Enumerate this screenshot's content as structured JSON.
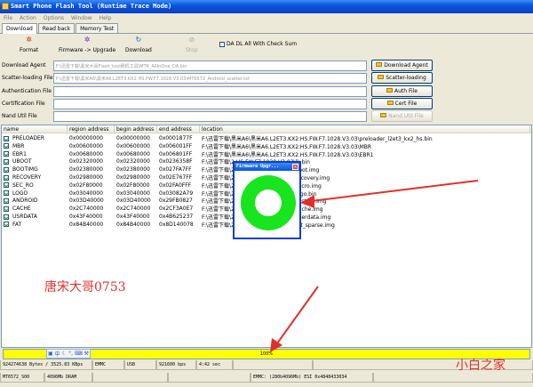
{
  "window": {
    "title": "Smart Phone Flash Tool (Runtime Trace Mode)"
  },
  "menu": [
    "File",
    "Action",
    "Options",
    "Window",
    "Help"
  ],
  "tabs": [
    "Download",
    "Read back",
    "Memory Test"
  ],
  "toolbar": {
    "format": "Format",
    "firmware_upgrade": "Firmware -> Upgrade",
    "download": "Download",
    "stop": "Stop",
    "da_dl_all": "DA DL All With Check Sum"
  },
  "fields": [
    {
      "label": "Download Agent",
      "value": "F:\\迅雷下载\\黑米大哥Flash_tool刷机工具\\MTK_AllInOne_DA.bin",
      "button": "Download Agent",
      "enabled": true
    },
    {
      "label": "Scatter-loading File",
      "value": "F:\\迅雷下载\\黑米A6\\黑米A6.L2ET3.KX2.HS.FW.F7.1028.V3.03\\MT6572_Android_scatter.txt",
      "button": "Scatter-loading",
      "enabled": true
    },
    {
      "label": "Authentication File",
      "value": "",
      "button": "Auth File",
      "enabled": true
    },
    {
      "label": "Certification File",
      "value": "",
      "button": "Cert File",
      "enabled": true
    },
    {
      "label": "Nand Util File",
      "value": "",
      "button": "Nand Util File",
      "enabled": false
    }
  ],
  "table": {
    "headers": [
      "name",
      "region address",
      "begin address",
      "end address",
      "location"
    ],
    "rows": [
      {
        "name": "PRELOADER",
        "region": "0x00000000",
        "begin": "0x00000000",
        "end": "0x0001877F",
        "location": "F:\\迅雷下载\\黑米A6\\黑米A6.L2ET3.KX2.HS.FW.F7.1028.V3.03\\preloader_l2et3_kx2_hs.bin"
      },
      {
        "name": "MBR",
        "region": "0x00600000",
        "begin": "0x00600000",
        "end": "0x006001FF",
        "location": "F:\\迅雷下载\\黑米A6\\黑米A6.L2ET3.KX2.HS.FW.F7.1028.V3.03\\MBR"
      },
      {
        "name": "EBR1",
        "region": "0x00680000",
        "begin": "0x00680000",
        "end": "0x006801FF",
        "location": "F:\\迅雷下载\\黑米A6\\黑米A6.L2ET3.KX2.HS.FW.F7.1028.V3.03\\EBR1"
      },
      {
        "name": "UBOOT",
        "region": "0x02320000",
        "begin": "0x02320000",
        "end": "0x0236358F",
        "location": "F:\\迅雷下载\\2:HS.FW.F7.1028.V3.03\\lk.bin"
      },
      {
        "name": "BOOTIMG",
        "region": "0x02380000",
        "begin": "0x02380000",
        "end": "0x027FA7FF",
        "location": "F:\\迅雷下载\\2:HS.FW.F7.1028.V3.03\\boot.img"
      },
      {
        "name": "RECOVERY",
        "region": "0x02980000",
        "begin": "0x02980000",
        "end": "0x02E767FF",
        "location": "F:\\迅雷下载\\2:HS.FW.F7.1028.V3.03\\recovery.img"
      },
      {
        "name": "SEC_RO",
        "region": "0x02F80000",
        "begin": "0x02F80000",
        "end": "0x02FA0FFF",
        "location": "F:\\迅雷下载\\2:HS.FW.F7.1028.V3.03\\secro.img"
      },
      {
        "name": "LOGO",
        "region": "0x03040000",
        "begin": "0x03040000",
        "end": "0x03082A79",
        "location": "F:\\迅雷下载\\2:HS.FW.F7.1028.V3.03\\logo.bin"
      },
      {
        "name": "ANDROID",
        "region": "0x03D40000",
        "begin": "0x03D40000",
        "end": "0x29FB0827",
        "location": "F:\\迅雷下载\\2:HS.FW.F7.1028.V3.03\\system.img"
      },
      {
        "name": "CACHE",
        "region": "0x2C740000",
        "begin": "0x2C740000",
        "end": "0x2CF3A0E7",
        "location": "F:\\迅雷下载\\2:HS.FW.F7.1028.V3.03\\cache.img"
      },
      {
        "name": "USRDATA",
        "region": "0x43F40000",
        "begin": "0x43F40000",
        "end": "0x4B625237",
        "location": "F:\\迅雷下载\\2:HS.FW.F7.1028.V3.03\\userdata.img"
      },
      {
        "name": "FAT",
        "region": "0x84B40000",
        "begin": "0x84B40000",
        "end": "0x8D140078",
        "location": "F:\\迅雷下载\\2:HS.FW.F7.1028.V3.03\\fat_sparse.img"
      }
    ]
  },
  "dialog": {
    "title": "Firmware Upgr..."
  },
  "watermarks": {
    "left": "唐宋大哥0753",
    "right": "小白之家"
  },
  "progress": {
    "label": "100%",
    "fraction": 1.0,
    "color": "#ffff00"
  },
  "ime": "中",
  "status": [
    "924274638 Bytes / 3525.83 KBps",
    "EMMC",
    "USB",
    "921600 bps",
    "4:42 sec",
    "",
    ""
  ],
  "status2": [
    "MT6572_S00",
    "4096Mb DRAM",
    "",
    "",
    "EMMC: (280b4096Mb) ESI 0x4848433034",
    ""
  ],
  "colors": {
    "ring": "#18e51e",
    "arrow": "#e0302b",
    "watermark": "#e0302b"
  }
}
